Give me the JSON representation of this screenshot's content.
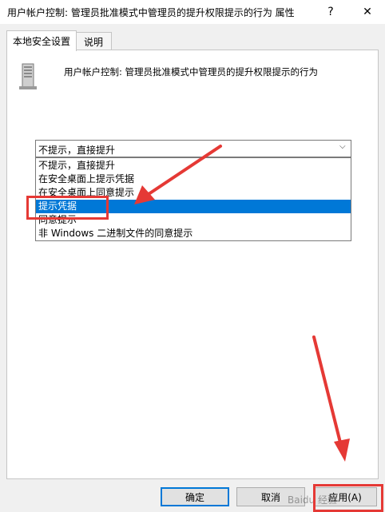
{
  "window": {
    "title": "用户帐户控制: 管理员批准模式中管理员的提升权限提示的行为 属性",
    "help_glyph": "?",
    "close_glyph": "✕"
  },
  "tabs": [
    {
      "label": "本地安全设置",
      "active": true
    },
    {
      "label": "说明",
      "active": false
    }
  ],
  "policy": {
    "title": "用户帐户控制: 管理员批准模式中管理员的提升权限提示的行为",
    "icon": "server-icon"
  },
  "combo": {
    "value": "不提示，直接提升",
    "arrow_glyph": "⌵"
  },
  "dropdown": {
    "options": [
      "不提示，直接提升",
      "在安全桌面上提示凭据",
      "在安全桌面上同意提示",
      "提示凭据",
      "同意提示",
      "非 Windows 二进制文件的同意提示"
    ],
    "selected_index": 3
  },
  "buttons": {
    "ok": "确定",
    "cancel": "取消",
    "apply": "应用(A)"
  },
  "watermark": "Baidu 经验",
  "colors": {
    "selection": "#0078d7",
    "annotation": "#e53935",
    "panel_bg": "#ffffff",
    "window_bg": "#f0f0f0"
  }
}
